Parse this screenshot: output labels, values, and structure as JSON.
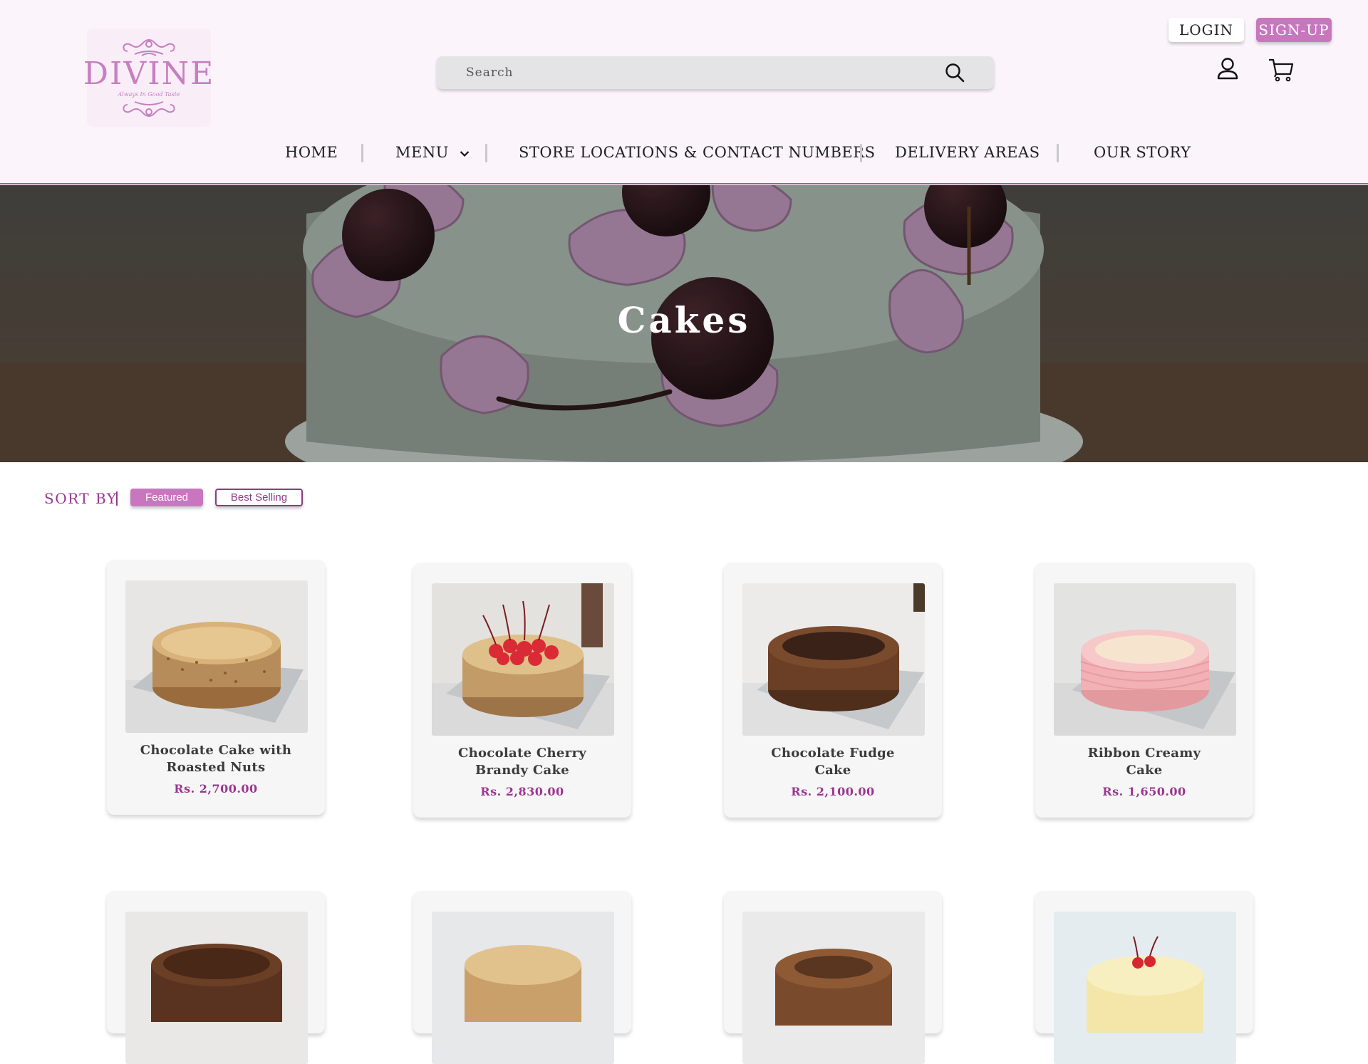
{
  "brand": {
    "name": "DIVINE",
    "tagline": "Always In Good Taste"
  },
  "search": {
    "placeholder": "Search"
  },
  "auth": {
    "login_label": "LOGIN",
    "signup_label": "SIGN-UP"
  },
  "nav": {
    "items": [
      {
        "label": "HOME"
      },
      {
        "label": "MENU"
      },
      {
        "label": "STORE LOCATIONS  &  CONTACT NUMBERS"
      },
      {
        "label": "DELIVERY AREAS"
      },
      {
        "label": "OUR STORY"
      }
    ]
  },
  "hero": {
    "title": "Cakes"
  },
  "sort": {
    "label": "SORT BY",
    "options": [
      {
        "label": "Featured",
        "active": true
      },
      {
        "label": "Best Selling",
        "active": false
      }
    ]
  },
  "products": [
    {
      "name_line1": "Chocolate Cake with",
      "name_line2": "Roasted Nuts",
      "price": "Rs. 2,700.00"
    },
    {
      "name_line1": "Chocolate Cherry",
      "name_line2": "Brandy Cake",
      "price": "Rs. 2,830.00"
    },
    {
      "name_line1": "Chocolate Fudge",
      "name_line2": "Cake",
      "price": "Rs. 2,100.00"
    },
    {
      "name_line1": "Ribbon Creamy",
      "name_line2": "Cake",
      "price": "Rs. 1,650.00"
    }
  ],
  "colors": {
    "accent": "#c877bf",
    "accent_dark": "#9b3590",
    "header_bg": "#fbf4fb"
  }
}
